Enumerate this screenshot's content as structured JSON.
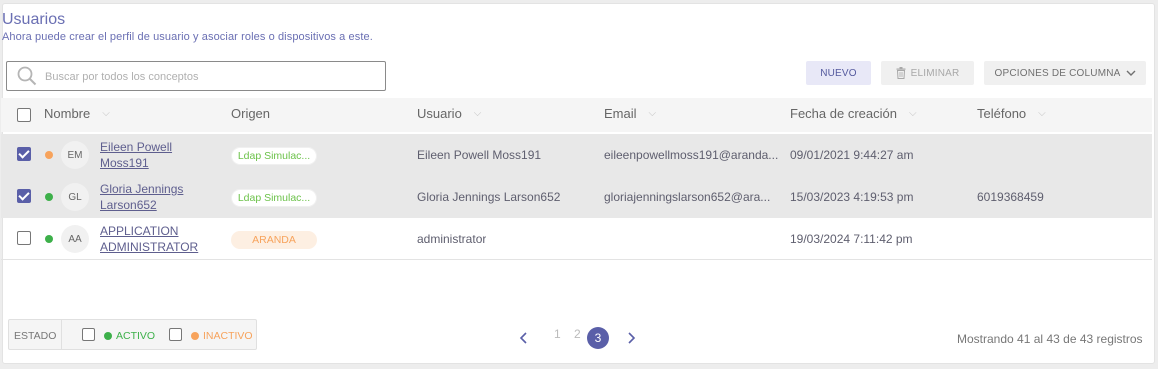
{
  "header": {
    "title": "Usuarios",
    "subtitle": "Ahora puede crear el perfil de usuario y asociar roles o dispositivos a este."
  },
  "search": {
    "placeholder": "Buscar por todos los conceptos",
    "value": ""
  },
  "toolbar": {
    "new_label": "NUEVO",
    "delete_label": "ELIMINAR",
    "columns_label": "OPCIONES DE COLUMNA"
  },
  "table": {
    "columns": [
      "Nombre",
      "Origen",
      "Usuario",
      "Email",
      "Fecha de creación",
      "Teléfono"
    ],
    "rows": [
      {
        "selected": true,
        "status": "inactive",
        "status_color": "#f7a35c",
        "initials": "EM",
        "name": "Eileen Powell Moss191",
        "origin": "Ldap Simulac...",
        "origin_type": "ldap",
        "username": "Eileen Powell Moss191",
        "email": "eileenpowellmoss191@aranda...",
        "created": "09/01/2021 9:44:27 am",
        "phone": ""
      },
      {
        "selected": true,
        "status": "active",
        "status_color": "#3db04a",
        "initials": "GL",
        "name": "Gloria Jennings Larson652",
        "origin": "Ldap Simulac...",
        "origin_type": "ldap",
        "username": "Gloria Jennings Larson652",
        "email": "gloriajenningslarson652@ara...",
        "created": "15/03/2023 4:19:53 pm",
        "phone": "6019368459"
      },
      {
        "selected": false,
        "status": "active",
        "status_color": "#3db04a",
        "initials": "AA",
        "name": "APPLICATION ADMINISTRATOR",
        "origin": "ARANDA",
        "origin_type": "aranda",
        "username": "administrator",
        "email": "",
        "created": "19/03/2024 7:11:42 pm",
        "phone": ""
      }
    ]
  },
  "footer": {
    "filter_label": "ESTADO",
    "active_label": "ACTIVO",
    "inactive_label": "INACTIVO",
    "pages": [
      "1",
      "2",
      "3"
    ],
    "current_page": "3",
    "records_prefix": "Mostrando",
    "records_from": "41",
    "records_to_word": "al",
    "records_to": "43",
    "records_of_word": "de",
    "records_total": "43",
    "records_suffix": "registros"
  },
  "colors": {
    "accent": "#5a5fa8",
    "title": "#6a6fb3",
    "active": "#3db04a",
    "inactive": "#f7a35c"
  },
  "icons": [
    "search-icon",
    "trash-icon",
    "chevron-down-icon",
    "sort-chevron-icon",
    "chevron-left-icon",
    "chevron-right-icon"
  ]
}
